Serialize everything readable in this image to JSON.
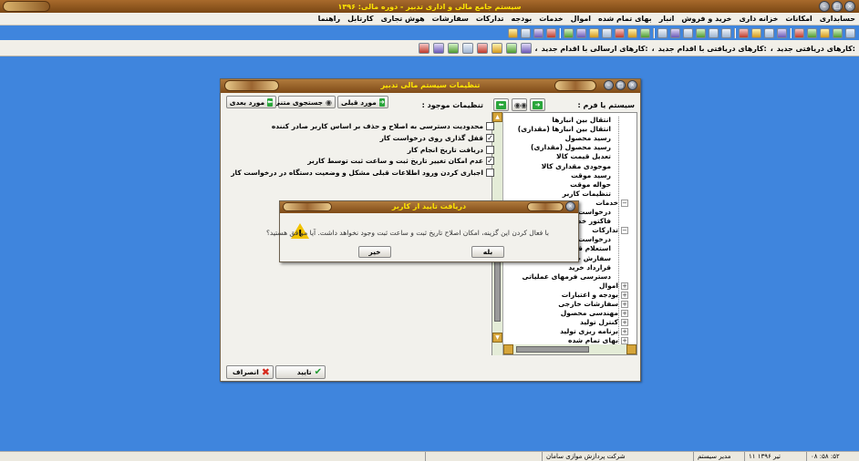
{
  "app": {
    "title": "سیستم جامع مالی و اداری تدبیر - دوره مالی: ۱۳۹۶"
  },
  "menu": [
    "حسابداری",
    "امکانات",
    "خزانه داری",
    "خرید و فروش",
    "انبار",
    "بهای تمام شده",
    "اموال",
    "خدمات",
    "بودجه",
    "تدارکات",
    "سفارشات",
    "هوش تجاری",
    "کارتابل",
    "راهنما"
  ],
  "shortcuts": {
    "received_new": "کارهای دریافتی جدید:",
    "received_action": "کارهای دریافتی با اقدام جدید:",
    "sent_action": "کارهای ارسالی با اقدام جدید:",
    "sep": "،"
  },
  "settings_dialog": {
    "title": "تنظیمات سیستم مالی تدبیر",
    "system_by_form_label": "سیستم یا فرم :",
    "existing_settings_label": "تنظیمات موجود :",
    "prev_label": "مورد قبلی",
    "search_text_label": "جستجوی متنی",
    "next_label": "مورد بعدی",
    "tree": [
      {
        "label": "انتقال بین انبارها",
        "expander": ""
      },
      {
        "label": "انتقال بین انبارها (مقداری)",
        "expander": ""
      },
      {
        "label": "رسید محصول",
        "expander": ""
      },
      {
        "label": "رسید محصول (مقداری)",
        "expander": ""
      },
      {
        "label": "تعدیل قیمت کالا",
        "expander": ""
      },
      {
        "label": "موجودی مقداری کالا",
        "expander": ""
      },
      {
        "label": "رسید موقت",
        "expander": ""
      },
      {
        "label": "حواله موقت",
        "expander": ""
      },
      {
        "label": "تنظیمات کاربر",
        "expander": ""
      },
      {
        "label": "خدمات",
        "expander": "−"
      },
      {
        "label": "درخواست",
        "expander": ""
      },
      {
        "label": "فاکتور خدمات",
        "expander": ""
      },
      {
        "label": "تدارکات",
        "expander": "−"
      },
      {
        "label": "درخواست",
        "expander": ""
      },
      {
        "label": "استعلام قیمت",
        "expander": ""
      },
      {
        "label": "سفارش خرید",
        "expander": ""
      },
      {
        "label": "قرارداد خرید",
        "expander": ""
      },
      {
        "label": "دسترسی فرمهای عملیاتی",
        "expander": ""
      },
      {
        "label": "اموال",
        "expander": "+"
      },
      {
        "label": "بودجه و اعتبارات",
        "expander": "+"
      },
      {
        "label": "سفارشات خارجی",
        "expander": "+"
      },
      {
        "label": "مهندسی محصول",
        "expander": "+"
      },
      {
        "label": "کنترل تولید",
        "expander": "+"
      },
      {
        "label": "برنامه ریزی تولید",
        "expander": "+"
      },
      {
        "label": "بهای تمام شده",
        "expander": "+"
      }
    ],
    "options": [
      {
        "label": "محدودیت دسترسی به اصلاح و حذف بر اساس کاربر صادر کننده",
        "checked": false
      },
      {
        "label": "قفل گذاری روی درخواست کار",
        "checked": true
      },
      {
        "label": "دریافت تاریخ انجام کار",
        "checked": false
      },
      {
        "label": "عدم امکان تغییر تاریخ ثبت و ساعت ثبت توسط کاربر",
        "checked": true
      },
      {
        "label": "اجباری کردن ورود اطلاعات قبلی مشکل و وضعیت دستگاه در درخواست کار",
        "checked": false
      }
    ],
    "confirm_label": "تایید",
    "cancel_label": "انصراف"
  },
  "confirm_dialog": {
    "title": "دریافت تایید از کاربر",
    "message": "با فعال کردن این گزینه، امکان اصلاح تاریخ ثبت و ساعت ثبت وجود نخواهد داشت. آیا موافق هستید؟",
    "yes_label": "بله",
    "no_label": "خیر"
  },
  "status": {
    "time": "۰۸ :۵۸ :۵۲",
    "date": "۱۱ تیر ۱۳۹۶",
    "user": "مدیر سیستم",
    "company": "شرکت پردازش موازی سامان"
  },
  "colors": {
    "desktop": "#3f85dd",
    "title_text": "#ffe600",
    "titlebar": "#8b5520"
  }
}
